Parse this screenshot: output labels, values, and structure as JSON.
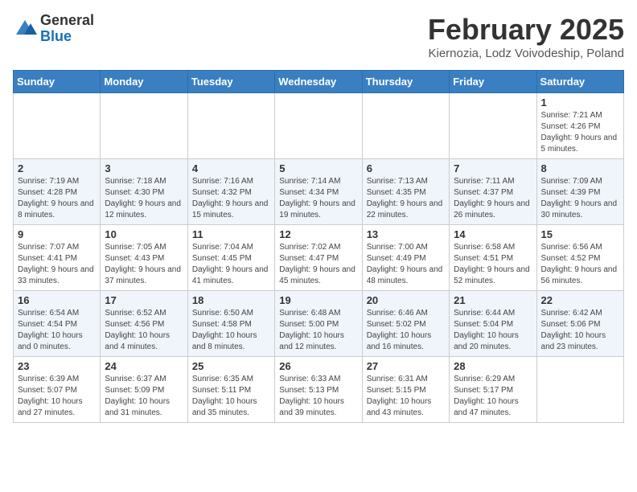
{
  "logo": {
    "general": "General",
    "blue": "Blue"
  },
  "title": "February 2025",
  "subtitle": "Kiernozia, Lodz Voivodeship, Poland",
  "weekdays": [
    "Sunday",
    "Monday",
    "Tuesday",
    "Wednesday",
    "Thursday",
    "Friday",
    "Saturday"
  ],
  "weeks": [
    [
      {
        "day": "",
        "info": ""
      },
      {
        "day": "",
        "info": ""
      },
      {
        "day": "",
        "info": ""
      },
      {
        "day": "",
        "info": ""
      },
      {
        "day": "",
        "info": ""
      },
      {
        "day": "",
        "info": ""
      },
      {
        "day": "1",
        "info": "Sunrise: 7:21 AM\nSunset: 4:26 PM\nDaylight: 9 hours and 5 minutes."
      }
    ],
    [
      {
        "day": "2",
        "info": "Sunrise: 7:19 AM\nSunset: 4:28 PM\nDaylight: 9 hours and 8 minutes."
      },
      {
        "day": "3",
        "info": "Sunrise: 7:18 AM\nSunset: 4:30 PM\nDaylight: 9 hours and 12 minutes."
      },
      {
        "day": "4",
        "info": "Sunrise: 7:16 AM\nSunset: 4:32 PM\nDaylight: 9 hours and 15 minutes."
      },
      {
        "day": "5",
        "info": "Sunrise: 7:14 AM\nSunset: 4:34 PM\nDaylight: 9 hours and 19 minutes."
      },
      {
        "day": "6",
        "info": "Sunrise: 7:13 AM\nSunset: 4:35 PM\nDaylight: 9 hours and 22 minutes."
      },
      {
        "day": "7",
        "info": "Sunrise: 7:11 AM\nSunset: 4:37 PM\nDaylight: 9 hours and 26 minutes."
      },
      {
        "day": "8",
        "info": "Sunrise: 7:09 AM\nSunset: 4:39 PM\nDaylight: 9 hours and 30 minutes."
      }
    ],
    [
      {
        "day": "9",
        "info": "Sunrise: 7:07 AM\nSunset: 4:41 PM\nDaylight: 9 hours and 33 minutes."
      },
      {
        "day": "10",
        "info": "Sunrise: 7:05 AM\nSunset: 4:43 PM\nDaylight: 9 hours and 37 minutes."
      },
      {
        "day": "11",
        "info": "Sunrise: 7:04 AM\nSunset: 4:45 PM\nDaylight: 9 hours and 41 minutes."
      },
      {
        "day": "12",
        "info": "Sunrise: 7:02 AM\nSunset: 4:47 PM\nDaylight: 9 hours and 45 minutes."
      },
      {
        "day": "13",
        "info": "Sunrise: 7:00 AM\nSunset: 4:49 PM\nDaylight: 9 hours and 48 minutes."
      },
      {
        "day": "14",
        "info": "Sunrise: 6:58 AM\nSunset: 4:51 PM\nDaylight: 9 hours and 52 minutes."
      },
      {
        "day": "15",
        "info": "Sunrise: 6:56 AM\nSunset: 4:52 PM\nDaylight: 9 hours and 56 minutes."
      }
    ],
    [
      {
        "day": "16",
        "info": "Sunrise: 6:54 AM\nSunset: 4:54 PM\nDaylight: 10 hours and 0 minutes."
      },
      {
        "day": "17",
        "info": "Sunrise: 6:52 AM\nSunset: 4:56 PM\nDaylight: 10 hours and 4 minutes."
      },
      {
        "day": "18",
        "info": "Sunrise: 6:50 AM\nSunset: 4:58 PM\nDaylight: 10 hours and 8 minutes."
      },
      {
        "day": "19",
        "info": "Sunrise: 6:48 AM\nSunset: 5:00 PM\nDaylight: 10 hours and 12 minutes."
      },
      {
        "day": "20",
        "info": "Sunrise: 6:46 AM\nSunset: 5:02 PM\nDaylight: 10 hours and 16 minutes."
      },
      {
        "day": "21",
        "info": "Sunrise: 6:44 AM\nSunset: 5:04 PM\nDaylight: 10 hours and 20 minutes."
      },
      {
        "day": "22",
        "info": "Sunrise: 6:42 AM\nSunset: 5:06 PM\nDaylight: 10 hours and 23 minutes."
      }
    ],
    [
      {
        "day": "23",
        "info": "Sunrise: 6:39 AM\nSunset: 5:07 PM\nDaylight: 10 hours and 27 minutes."
      },
      {
        "day": "24",
        "info": "Sunrise: 6:37 AM\nSunset: 5:09 PM\nDaylight: 10 hours and 31 minutes."
      },
      {
        "day": "25",
        "info": "Sunrise: 6:35 AM\nSunset: 5:11 PM\nDaylight: 10 hours and 35 minutes."
      },
      {
        "day": "26",
        "info": "Sunrise: 6:33 AM\nSunset: 5:13 PM\nDaylight: 10 hours and 39 minutes."
      },
      {
        "day": "27",
        "info": "Sunrise: 6:31 AM\nSunset: 5:15 PM\nDaylight: 10 hours and 43 minutes."
      },
      {
        "day": "28",
        "info": "Sunrise: 6:29 AM\nSunset: 5:17 PM\nDaylight: 10 hours and 47 minutes."
      },
      {
        "day": "",
        "info": ""
      }
    ]
  ]
}
